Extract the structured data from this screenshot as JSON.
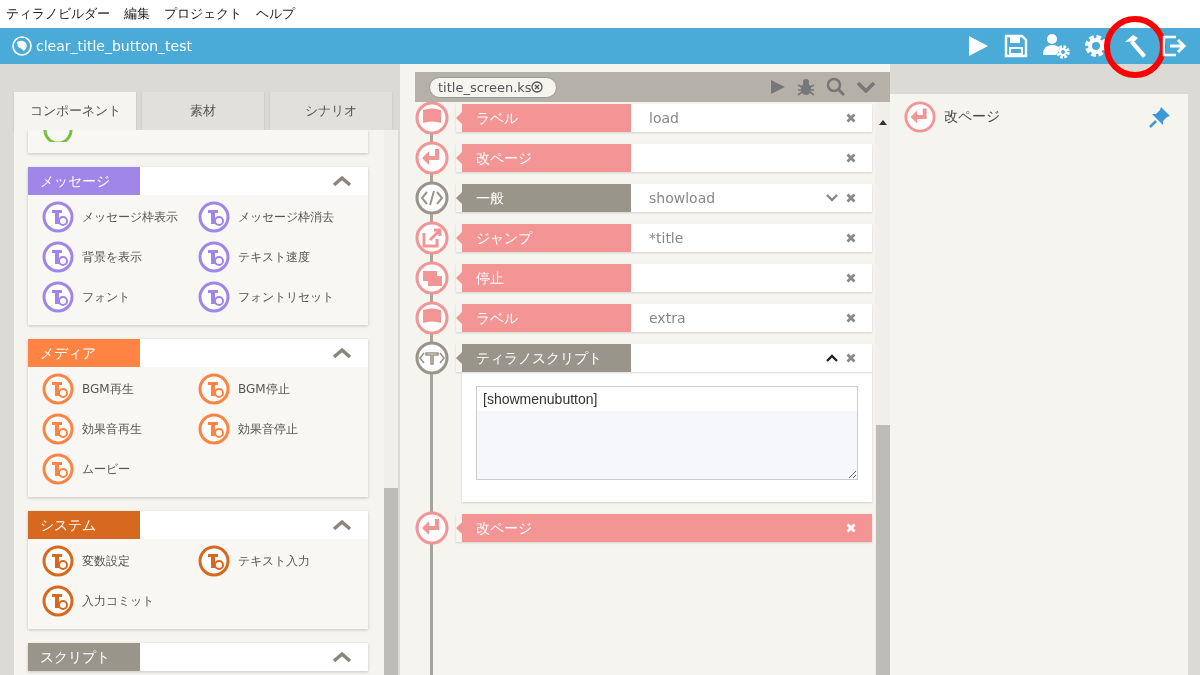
{
  "menu": [
    "ティラノビルダー",
    "編集",
    "プロジェクト",
    "ヘルプ"
  ],
  "title": "clear_title_button_test",
  "toolbar": [
    {
      "kind": "play",
      "highlighted": false
    },
    {
      "kind": "save",
      "highlighted": false
    },
    {
      "kind": "user-settings",
      "highlighted": false
    },
    {
      "kind": "settings",
      "highlighted": false
    },
    {
      "kind": "build",
      "highlighted": true
    },
    {
      "kind": "exit",
      "highlighted": false
    }
  ],
  "tabs": [
    {
      "label": "コンポーネント",
      "selected": true
    },
    {
      "label": "素材",
      "selected": false
    },
    {
      "label": "シナリオ",
      "selected": false
    }
  ],
  "sections": [
    {
      "title": "メッセージ",
      "color": "#a086e8",
      "expanded": true,
      "items": [
        "メッセージ枠表示",
        "メッセージ枠消去",
        "背景を表示",
        "テキスト速度",
        "フォント",
        "フォントリセット"
      ]
    },
    {
      "title": "メディア",
      "color": "#ff8444",
      "expanded": true,
      "items": [
        "BGM再生",
        "BGM停止",
        "効果音再生",
        "効果音停止",
        "ムービー"
      ]
    },
    {
      "title": "システム",
      "color": "#d6691f",
      "expanded": true,
      "items": [
        "変数設定",
        "テキスト入力",
        "入力コミット"
      ]
    },
    {
      "title": "スクリプト",
      "color": "#9a958a",
      "expanded": true
    }
  ],
  "file_tab": "title_screen.ks",
  "rows": [
    {
      "kind": "label",
      "label": "ラベル",
      "value": "load",
      "color": "#f39595",
      "selected": false
    },
    {
      "kind": "newpage",
      "label": "改ページ",
      "color": "#f39595",
      "selected": false
    },
    {
      "kind": "general",
      "label": "一般",
      "value": "showload",
      "color": "#9a958a",
      "selected": false
    },
    {
      "kind": "jump",
      "label": "ジャンプ",
      "value": "*title",
      "color": "#f39595",
      "selected": false
    },
    {
      "kind": "stop",
      "label": "停止",
      "color": "#f39595",
      "selected": false
    },
    {
      "kind": "label",
      "label": "ラベル",
      "value": "extra",
      "color": "#f39595",
      "selected": false
    },
    {
      "kind": "script",
      "label": "ティラノスクリプト",
      "color": "#9a958a",
      "selected": false,
      "expanded": true,
      "code": "[showmenubutton]"
    },
    {
      "kind": "newpage",
      "label": "改ページ",
      "color": "#f39595",
      "selected": true
    }
  ],
  "detail": {
    "label": "改ページ"
  }
}
